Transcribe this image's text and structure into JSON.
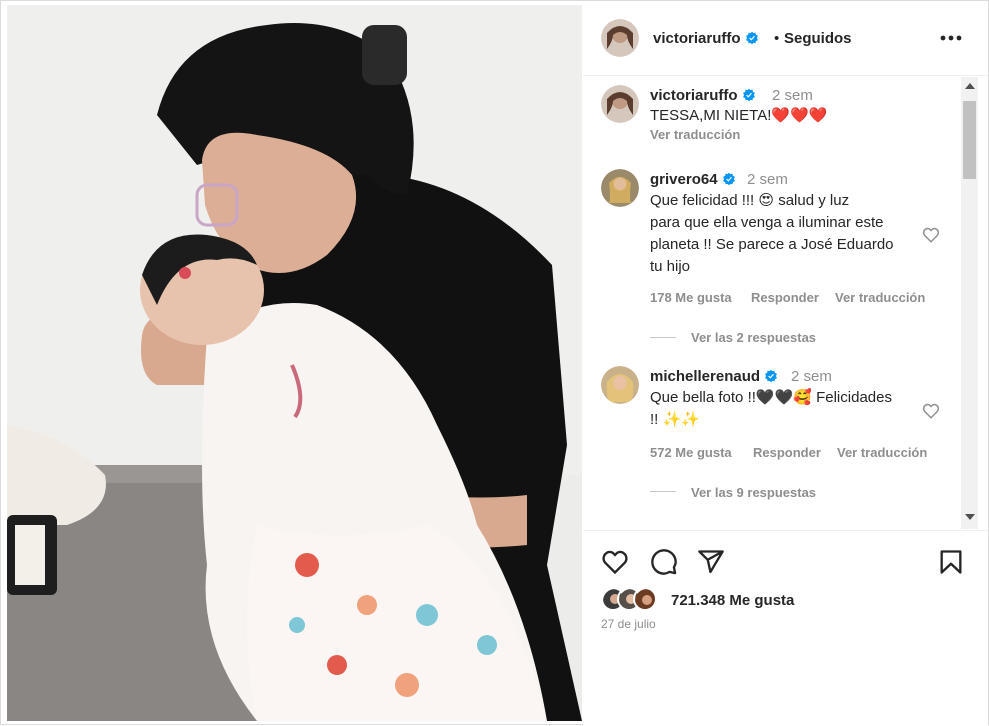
{
  "post": {
    "author": "victoriaruffo",
    "separator": "•",
    "follow_status": "Seguidos",
    "more_label": "More options"
  },
  "caption": {
    "username": "victoriaruffo",
    "time": "2 sem",
    "text": "TESSA,MI NIETA!❤️❤️❤️",
    "translate": "Ver traducción"
  },
  "comments": [
    {
      "username": "grivero64",
      "time": "2 sem",
      "text": [
        "Que felicidad !!! 😍 salud y luz",
        "para que ella venga a iluminar este",
        "planeta !! Se parece a José Eduardo",
        "tu hijo"
      ],
      "likes": "178 Me gusta",
      "reply": "Responder",
      "translate": "Ver traducción",
      "replies": "Ver las 2 respuestas"
    },
    {
      "username": "michellerenaud",
      "time": "2 sem",
      "text": [
        "Que bella foto !!🖤🖤🥰 Felicidades",
        "!! ✨✨"
      ],
      "likes": "572 Me gusta",
      "reply": "Responder",
      "translate": "Ver traducción",
      "replies": "Ver las 9 respuestas"
    }
  ],
  "footer": {
    "likes": "721.348 Me gusta",
    "date": "27 de julio"
  },
  "icons": {
    "verified": "verified-badge-icon",
    "like": "heart-icon",
    "comment": "comment-icon",
    "share": "share-icon",
    "save": "bookmark-icon",
    "more": "ellipsis-icon"
  },
  "colors": {
    "verified_blue": "#0095f6",
    "muted_text": "#8e8e8e",
    "primary_text": "#262626"
  }
}
